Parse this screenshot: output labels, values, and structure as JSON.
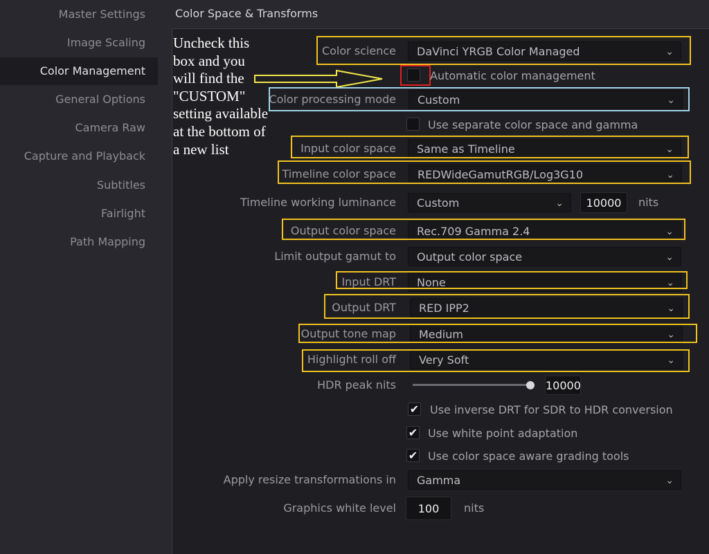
{
  "sidebar": {
    "items": [
      {
        "label": "Master Settings"
      },
      {
        "label": "Image Scaling"
      },
      {
        "label": "Color Management"
      },
      {
        "label": "General Options"
      },
      {
        "label": "Camera Raw"
      },
      {
        "label": "Capture and Playback"
      },
      {
        "label": "Subtitles"
      },
      {
        "label": "Fairlight"
      },
      {
        "label": "Path Mapping"
      }
    ]
  },
  "section_title": "Color Space & Transforms",
  "annotation": {
    "note": "Uncheck this box and you will find the \"CUSTOM\" setting available at the bottom of a new list"
  },
  "settings": {
    "color_science": {
      "label": "Color science",
      "value": "DaVinci YRGB Color Managed"
    },
    "auto_color_mgmt": {
      "label": "Automatic color management",
      "checked": false
    },
    "processing_mode": {
      "label": "Color processing mode",
      "value": "Custom"
    },
    "separate_space": {
      "label": "Use separate color space and gamma",
      "checked": false
    },
    "input_space": {
      "label": "Input color space",
      "value": "Same as Timeline"
    },
    "timeline_space": {
      "label": "Timeline color space",
      "value": "REDWideGamutRGB/Log3G10"
    },
    "working_lum": {
      "label": "Timeline working luminance",
      "value": "Custom",
      "nits_value": "10000",
      "unit": "nits"
    },
    "output_space": {
      "label": "Output color space",
      "value": "Rec.709 Gamma 2.4"
    },
    "limit_gamut": {
      "label": "Limit output gamut to",
      "value": "Output color space"
    },
    "input_drt": {
      "label": "Input DRT",
      "value": "None"
    },
    "output_drt": {
      "label": "Output DRT",
      "value": "RED IPP2"
    },
    "tone_map": {
      "label": "Output tone map",
      "value": "Medium"
    },
    "rolloff": {
      "label": "Highlight roll off",
      "value": "Very Soft"
    },
    "hdr_peak": {
      "label": "HDR peak nits",
      "value": "10000",
      "slider_fraction": 1.0
    },
    "inverse_drt": {
      "label": "Use inverse DRT for SDR to HDR conversion",
      "checked": true
    },
    "white_point": {
      "label": "Use white point adaptation",
      "checked": true
    },
    "aware_tools": {
      "label": "Use color space aware grading tools",
      "checked": true
    },
    "resize": {
      "label": "Apply resize transformations in",
      "value": "Gamma"
    },
    "gfx_white": {
      "label": "Graphics white level",
      "value": "100",
      "unit": "nits"
    }
  },
  "icons": {
    "chevron": "chevron-down-icon",
    "check": "checkmark-icon"
  },
  "colors": {
    "highlight": "#f2c21e",
    "processing_highlight": "#9fd6ea",
    "checkbox_highlight": "#e02020"
  }
}
